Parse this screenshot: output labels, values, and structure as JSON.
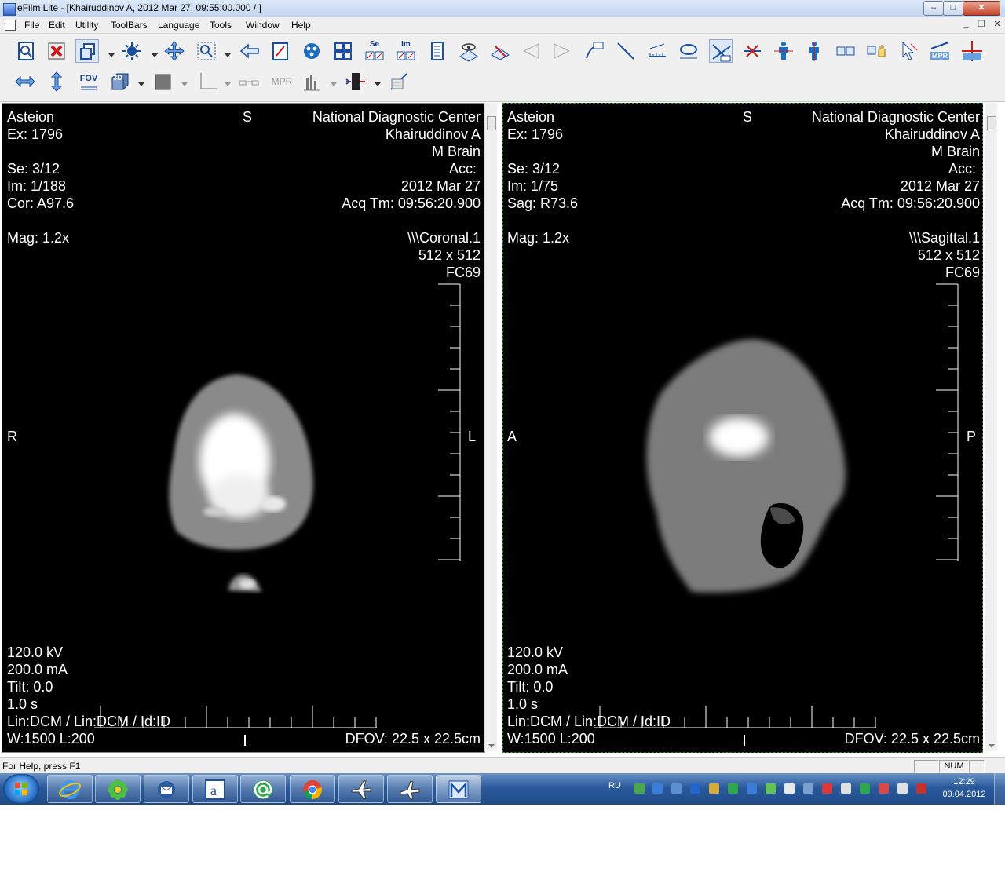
{
  "window": {
    "title": "eFilm Lite - [Khairuddinov A, 2012 Mar 27, 09:55:00.000  /  ]",
    "minimize": "–",
    "maximize": "□",
    "close": "✕"
  },
  "menu": {
    "items": [
      "File",
      "Edit",
      "Utility",
      "ToolBars",
      "Language",
      "Tools",
      "Window",
      "Help"
    ],
    "mdi_min": "_",
    "mdi_restore": "❐",
    "mdi_close": "✕"
  },
  "toolbar": {
    "row1_icons": [
      "zoom-page-icon",
      "close-study-icon",
      "copy-icon",
      "window-level-icon",
      "pan-icon",
      "zoom-icon",
      "back-arrow-icon",
      "edit-icon",
      "cine-icon",
      "layout-grid-icon",
      "series-link-icon",
      "image-link-icon",
      "report-icon",
      "eye-view-icon",
      "scan-icon",
      "prev-slice-icon",
      "next-slice-icon",
      "measure-35-icon",
      "line-icon",
      "ruler-icon",
      "ellipse-roi-icon",
      "angle-icon",
      "delete-annotation-icon",
      "person-front-icon",
      "person-back-icon",
      "flip-icon",
      "hand-icon",
      "cursor-icon",
      "mpr-icon",
      "mpr-cross-icon"
    ],
    "series_label": "Se",
    "image_label": "Im",
    "fov_label": "FOV",
    "threed_label": "3D",
    "mpr_text": "MPR",
    "mpr_small": "MPR"
  },
  "viewports": [
    {
      "top_left": [
        "Asteion",
        "Ex: 1796",
        "",
        "Se: 3/12",
        "Im: 1/188",
        "Cor: A97.6",
        "",
        "Mag: 1.2x"
      ],
      "top_center": "S",
      "top_right": [
        "National Diagnostic Center",
        "Khairuddinov A",
        "M  Brain",
        "Acc:",
        "2012 Mar 27",
        "Acq Tm: 09:56:20.900",
        "",
        "\\\\\\Coronal.1",
        "512 x 512",
        "FC69"
      ],
      "side_left": "R",
      "side_right": "L",
      "bottom_left": [
        "120.0 kV",
        "200.0 mA",
        "Tilt: 0.0",
        "1.0 s",
        "Lin:DCM / Lin:DCM / Id:ID",
        "W:1500  L:200"
      ],
      "bottom_right": "DFOV: 22.5 x 22.5cm"
    },
    {
      "top_left": [
        "Asteion",
        "Ex: 1796",
        "",
        "Se: 3/12",
        "Im: 1/75",
        "Sag: R73.6",
        "",
        "Mag: 1.2x"
      ],
      "top_center": "S",
      "top_right": [
        "National Diagnostic Center",
        "Khairuddinov A",
        "M  Brain",
        "Acc:",
        "2012 Mar 27",
        "Acq Tm: 09:56:20.900",
        "",
        "\\\\\\Sagittal.1",
        "512 x 512",
        "FC69"
      ],
      "side_left": "A",
      "side_right": "P",
      "bottom_left": [
        "120.0 kV",
        "200.0 mA",
        "Tilt: 0.0",
        "1.0 s",
        "Lin:DCM / Lin:DCM / Id:ID",
        "W:1500  L:200"
      ],
      "bottom_right": "DFOV: 22.5 x 22.5cm"
    }
  ],
  "status": {
    "help": "For Help, press F1",
    "num": "NUM"
  },
  "taskbar": {
    "apps": [
      "internet-explorer-icon",
      "icq-icon",
      "thunderbird-icon",
      "text-editor-icon",
      "mail-agent-icon",
      "chrome-icon",
      "airplane-icon",
      "airplane-alt-icon",
      "efilm-icon"
    ],
    "lang": "RU",
    "time": "12:29",
    "date": "09.04.2012",
    "tray_colors": [
      "#4aa84a",
      "#3a7dd8",
      "#5a8fd0",
      "#2266cc",
      "#d9a93a",
      "#2ea84a",
      "#3a7dd8",
      "#63c25a",
      "#e8e8e8",
      "#7aa0d0",
      "#d83a3a",
      "#e0e0e0",
      "#2ea84a",
      "#d84a4a",
      "#e0e0e0",
      "#c83030"
    ]
  }
}
